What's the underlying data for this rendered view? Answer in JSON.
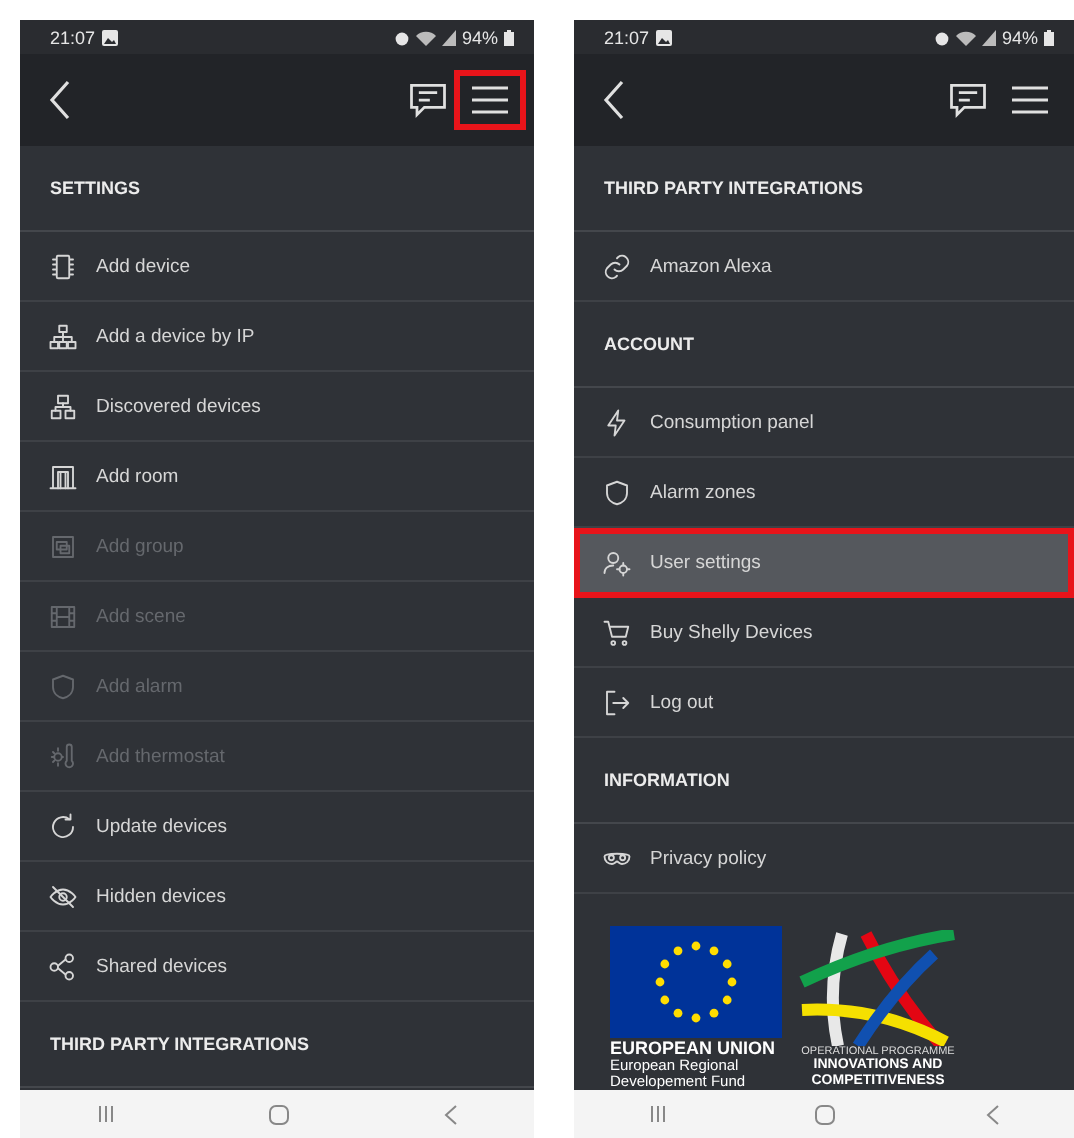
{
  "screens": [
    {
      "status_bar": {
        "time": "21:07",
        "battery": "94%"
      },
      "header": {
        "menu_highlighted": true
      },
      "sections": [
        {
          "title": "SETTINGS",
          "items": [
            {
              "kind": "device",
              "label": "Add device",
              "disabled": false,
              "highlighted": false
            },
            {
              "kind": "network",
              "label": "Add a device by IP",
              "disabled": false,
              "highlighted": false
            },
            {
              "kind": "discovered",
              "label": "Discovered devices",
              "disabled": false,
              "highlighted": false
            },
            {
              "kind": "room",
              "label": "Add room",
              "disabled": false,
              "highlighted": false
            },
            {
              "kind": "group",
              "label": "Add group",
              "disabled": true,
              "highlighted": false
            },
            {
              "kind": "scene",
              "label": "Add scene",
              "disabled": true,
              "highlighted": false
            },
            {
              "kind": "alarm",
              "label": "Add alarm",
              "disabled": true,
              "highlighted": false
            },
            {
              "kind": "thermostat",
              "label": "Add thermostat",
              "disabled": true,
              "highlighted": false
            },
            {
              "kind": "update",
              "label": "Update devices",
              "disabled": false,
              "highlighted": false
            },
            {
              "kind": "hidden",
              "label": "Hidden devices",
              "disabled": false,
              "highlighted": false
            },
            {
              "kind": "shared",
              "label": "Shared devices",
              "disabled": false,
              "highlighted": false
            }
          ]
        },
        {
          "title": "THIRD PARTY INTEGRATIONS"
        }
      ]
    },
    {
      "status_bar": {
        "time": "21:07",
        "battery": "94%"
      },
      "header": {
        "menu_highlighted": false
      },
      "sections": [
        {
          "title": "THIRD PARTY INTEGRATIONS",
          "items": [
            {
              "kind": "link",
              "label": "Amazon Alexa",
              "disabled": false,
              "highlighted": false
            }
          ]
        },
        {
          "title": "ACCOUNT",
          "items": [
            {
              "kind": "bolt",
              "label": "Consumption panel",
              "disabled": false,
              "highlighted": false
            },
            {
              "kind": "alarm",
              "label": "Alarm zones",
              "disabled": false,
              "highlighted": false
            },
            {
              "kind": "usergear",
              "label": "User settings",
              "disabled": false,
              "highlighted": true
            },
            {
              "kind": "cart",
              "label": "Buy Shelly Devices",
              "disabled": false,
              "highlighted": false
            },
            {
              "kind": "logout",
              "label": "Log out",
              "disabled": false,
              "highlighted": false
            }
          ]
        },
        {
          "title": "INFORMATION",
          "items": [
            {
              "kind": "mask",
              "label": "Privacy policy",
              "disabled": false,
              "highlighted": false
            }
          ]
        }
      ],
      "logos": {
        "eu": {
          "title": "EUROPEAN UNION",
          "lines": [
            "European Regional",
            "Developement Fund"
          ]
        },
        "programme": {
          "caption": "OPERATIONAL PROGRAMME",
          "lines": [
            "INNOVATIONS AND",
            "COMPETITIVENESS"
          ]
        }
      }
    }
  ]
}
